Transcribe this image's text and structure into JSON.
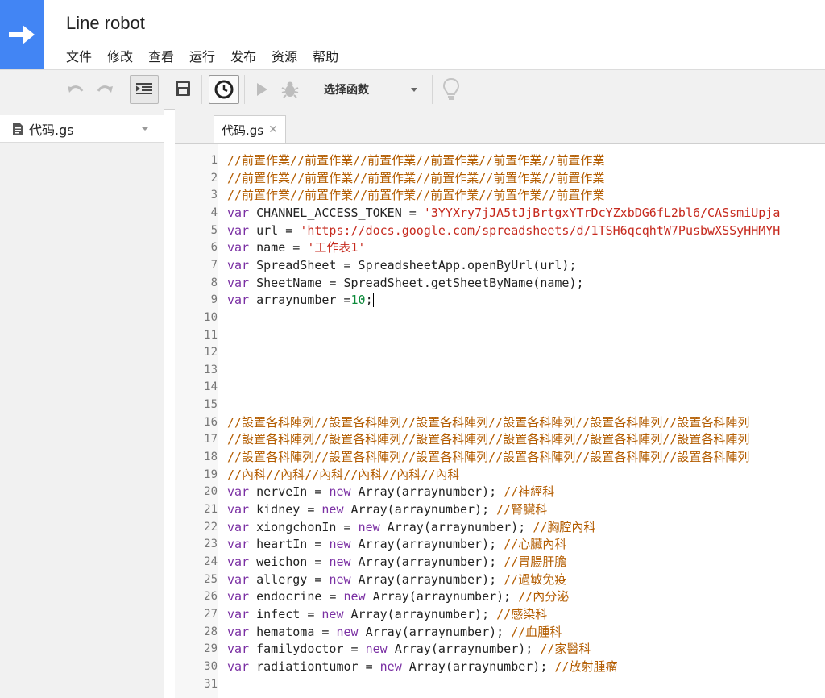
{
  "app": {
    "title": "Line robot",
    "menu": [
      "文件",
      "修改",
      "查看",
      "运行",
      "发布",
      "资源",
      "帮助"
    ]
  },
  "toolbar": {
    "function_select": "选择函数"
  },
  "sidebar": {
    "files": [
      {
        "name": "代码.gs"
      }
    ]
  },
  "editor": {
    "tab_label": "代码.gs",
    "lines": [
      [
        {
          "t": "//前置作業//前置作業//前置作業//前置作業//前置作業//前置作業",
          "c": "cm"
        }
      ],
      [
        {
          "t": "//前置作業//前置作業//前置作業//前置作業//前置作業//前置作業",
          "c": "cm"
        }
      ],
      [
        {
          "t": "//前置作業//前置作業//前置作業//前置作業//前置作業//前置作業",
          "c": "cm"
        }
      ],
      [
        {
          "t": "var",
          "c": "kw"
        },
        {
          "t": " CHANNEL_ACCESS_TOKEN = "
        },
        {
          "t": "'3YYXry7jJA5tJjBrtgxYTrDcYZxbDG6fL2bl6/CASsmiUpja",
          "c": "st"
        }
      ],
      [
        {
          "t": "var",
          "c": "kw"
        },
        {
          "t": " url = "
        },
        {
          "t": "'https://docs.google.com/spreadsheets/d/1TSH6qcqhtW7PusbwXSSyHHMYH",
          "c": "st"
        }
      ],
      [
        {
          "t": "var",
          "c": "kw"
        },
        {
          "t": " name = "
        },
        {
          "t": "'工作表1'",
          "c": "st"
        }
      ],
      [
        {
          "t": "var",
          "c": "kw"
        },
        {
          "t": " SpreadSheet = SpreadsheetApp.openByUrl(url);"
        }
      ],
      [
        {
          "t": "var",
          "c": "kw"
        },
        {
          "t": " SheetName = SpreadSheet.getSheetByName(name);"
        }
      ],
      [
        {
          "t": "var",
          "c": "kw"
        },
        {
          "t": " arraynumber ="
        },
        {
          "t": "10",
          "c": "nm"
        },
        {
          "t": ";"
        }
      ],
      [],
      [],
      [],
      [],
      [],
      [],
      [
        {
          "t": "//設置各科陣列//設置各科陣列//設置各科陣列//設置各科陣列//設置各科陣列//設置各科陣列",
          "c": "cm"
        }
      ],
      [
        {
          "t": "//設置各科陣列//設置各科陣列//設置各科陣列//設置各科陣列//設置各科陣列//設置各科陣列",
          "c": "cm"
        }
      ],
      [
        {
          "t": "//設置各科陣列//設置各科陣列//設置各科陣列//設置各科陣列//設置各科陣列//設置各科陣列",
          "c": "cm"
        }
      ],
      [
        {
          "t": "//內科//內科//內科//內科//內科//內科",
          "c": "cm"
        }
      ],
      [
        {
          "t": "var",
          "c": "kw"
        },
        {
          "t": " nerveIn = "
        },
        {
          "t": "new",
          "c": "kw"
        },
        {
          "t": " Array(arraynumber); "
        },
        {
          "t": "//神經科",
          "c": "cm"
        }
      ],
      [
        {
          "t": "var",
          "c": "kw"
        },
        {
          "t": " kidney = "
        },
        {
          "t": "new",
          "c": "kw"
        },
        {
          "t": " Array(arraynumber); "
        },
        {
          "t": "//腎臟科",
          "c": "cm"
        }
      ],
      [
        {
          "t": "var",
          "c": "kw"
        },
        {
          "t": " xiongchonIn = "
        },
        {
          "t": "new",
          "c": "kw"
        },
        {
          "t": " Array(arraynumber); "
        },
        {
          "t": "//胸腔內科",
          "c": "cm"
        }
      ],
      [
        {
          "t": "var",
          "c": "kw"
        },
        {
          "t": " heartIn = "
        },
        {
          "t": "new",
          "c": "kw"
        },
        {
          "t": " Array(arraynumber); "
        },
        {
          "t": "//心臟內科",
          "c": "cm"
        }
      ],
      [
        {
          "t": "var",
          "c": "kw"
        },
        {
          "t": " weichon = "
        },
        {
          "t": "new",
          "c": "kw"
        },
        {
          "t": " Array(arraynumber); "
        },
        {
          "t": "//胃腸肝膽",
          "c": "cm"
        }
      ],
      [
        {
          "t": "var",
          "c": "kw"
        },
        {
          "t": " allergy = "
        },
        {
          "t": "new",
          "c": "kw"
        },
        {
          "t": " Array(arraynumber); "
        },
        {
          "t": "//過敏免疫",
          "c": "cm"
        }
      ],
      [
        {
          "t": "var",
          "c": "kw"
        },
        {
          "t": " endocrine = "
        },
        {
          "t": "new",
          "c": "kw"
        },
        {
          "t": " Array(arraynumber); "
        },
        {
          "t": "//內分泌",
          "c": "cm"
        }
      ],
      [
        {
          "t": "var",
          "c": "kw"
        },
        {
          "t": " infect = "
        },
        {
          "t": "new",
          "c": "kw"
        },
        {
          "t": " Array(arraynumber); "
        },
        {
          "t": "//感染科",
          "c": "cm"
        }
      ],
      [
        {
          "t": "var",
          "c": "kw"
        },
        {
          "t": " hematoma = "
        },
        {
          "t": "new",
          "c": "kw"
        },
        {
          "t": " Array(arraynumber); "
        },
        {
          "t": "//血腫科",
          "c": "cm"
        }
      ],
      [
        {
          "t": "var",
          "c": "kw"
        },
        {
          "t": " familydoctor = "
        },
        {
          "t": "new",
          "c": "kw"
        },
        {
          "t": " Array(arraynumber); "
        },
        {
          "t": "//家醫科",
          "c": "cm"
        }
      ],
      [
        {
          "t": "var",
          "c": "kw"
        },
        {
          "t": " radiationtumor = "
        },
        {
          "t": "new",
          "c": "kw"
        },
        {
          "t": " Array(arraynumber); "
        },
        {
          "t": "//放射腫瘤",
          "c": "cm"
        }
      ],
      []
    ],
    "cursor_line": 9
  },
  "icons": {
    "logo": "arrow-right-icon",
    "undo": "undo-icon",
    "redo": "redo-icon",
    "indent": "indent-icon",
    "save": "save-icon",
    "triggers": "clock-icon",
    "run": "play-icon",
    "debug": "bug-icon",
    "lightbulb": "lightbulb-icon",
    "file": "document-icon"
  },
  "colors": {
    "brand": "#4285f4",
    "keyword": "#7a2fa3",
    "comment": "#b35c00",
    "string": "#c6291d",
    "number": "#0c8a3a"
  }
}
